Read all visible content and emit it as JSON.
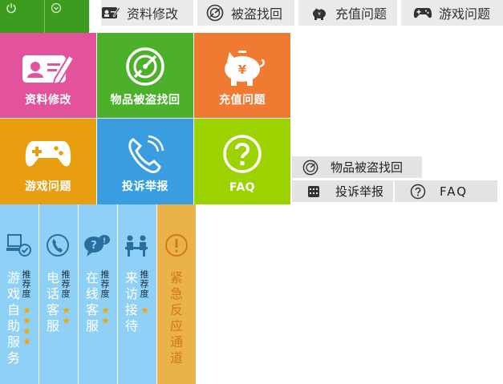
{
  "top_nav": [
    {
      "label": "资料修改",
      "icon": "id-card-icon"
    },
    {
      "label": "被盗找回",
      "icon": "radar-icon"
    },
    {
      "label": "充值问题",
      "icon": "piggy-bank-icon"
    },
    {
      "label": "游戏问题",
      "icon": "gamepad-icon"
    }
  ],
  "tiles": [
    {
      "label": "资料修改",
      "icon": "id-card-icon",
      "color": "#e2539b"
    },
    {
      "label": "物品被盗找回",
      "icon": "radar-icon",
      "color": "#4cb02b"
    },
    {
      "label": "充值问题",
      "icon": "piggy-bank-icon",
      "color": "#f07a31"
    },
    {
      "label": "游戏问题",
      "icon": "gamepad-icon",
      "color": "#e99e10"
    },
    {
      "label": "投诉举报",
      "icon": "phone-icon",
      "color": "#3a9de0"
    },
    {
      "label": "FAQ",
      "icon": "question-icon",
      "color": "#9bd200"
    }
  ],
  "side_menu": [
    {
      "label": "物品被盗找回",
      "icon": "radar-icon"
    },
    {
      "label": "投诉举报",
      "icon": "keypad-icon"
    },
    {
      "label": "FAQ",
      "icon": "question-icon"
    }
  ],
  "services": [
    {
      "title": "游戏自助服务",
      "tag": "推荐度",
      "stars": 4,
      "icon": "computer-check-icon"
    },
    {
      "title": "电话客服",
      "tag": "推荐度",
      "stars": 2,
      "icon": "phone-icon"
    },
    {
      "title": "在线客服",
      "tag": "推荐度",
      "stars": 2,
      "icon": "chat-bubble-icon"
    },
    {
      "title": "来访接待",
      "tag": "推荐度",
      "stars": 1,
      "icon": "reception-icon"
    },
    {
      "title": "紧急反应通道",
      "tag": "",
      "stars": 0,
      "icon": "alert-icon"
    }
  ],
  "star_glyph": "★",
  "colors": {
    "service_blue": "#8fd1f6",
    "service_orange": "#e9b24a",
    "star": "#f2a400"
  }
}
